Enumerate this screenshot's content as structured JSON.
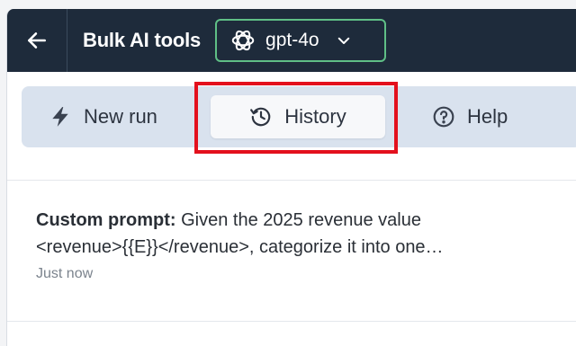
{
  "header": {
    "title": "Bulk AI tools",
    "model": "gpt-4o"
  },
  "tabs": [
    {
      "label": "New run",
      "icon": "lightning-icon"
    },
    {
      "label": "History",
      "icon": "history-icon",
      "active": true
    },
    {
      "label": "Help",
      "icon": "help-circle-icon"
    }
  ],
  "history_items": [
    {
      "prefix": "Custom prompt:",
      "text_line1": " Given the 2025 revenue value",
      "text_line2": "<revenue>{{E}}</revenue>, categorize it into one…",
      "timestamp": "Just now"
    }
  ],
  "colors": {
    "header_bg": "#1e2b3b",
    "model_border": "#5fbf86",
    "tabbar_bg": "#d9e2ee",
    "highlight": "#e3101d"
  }
}
